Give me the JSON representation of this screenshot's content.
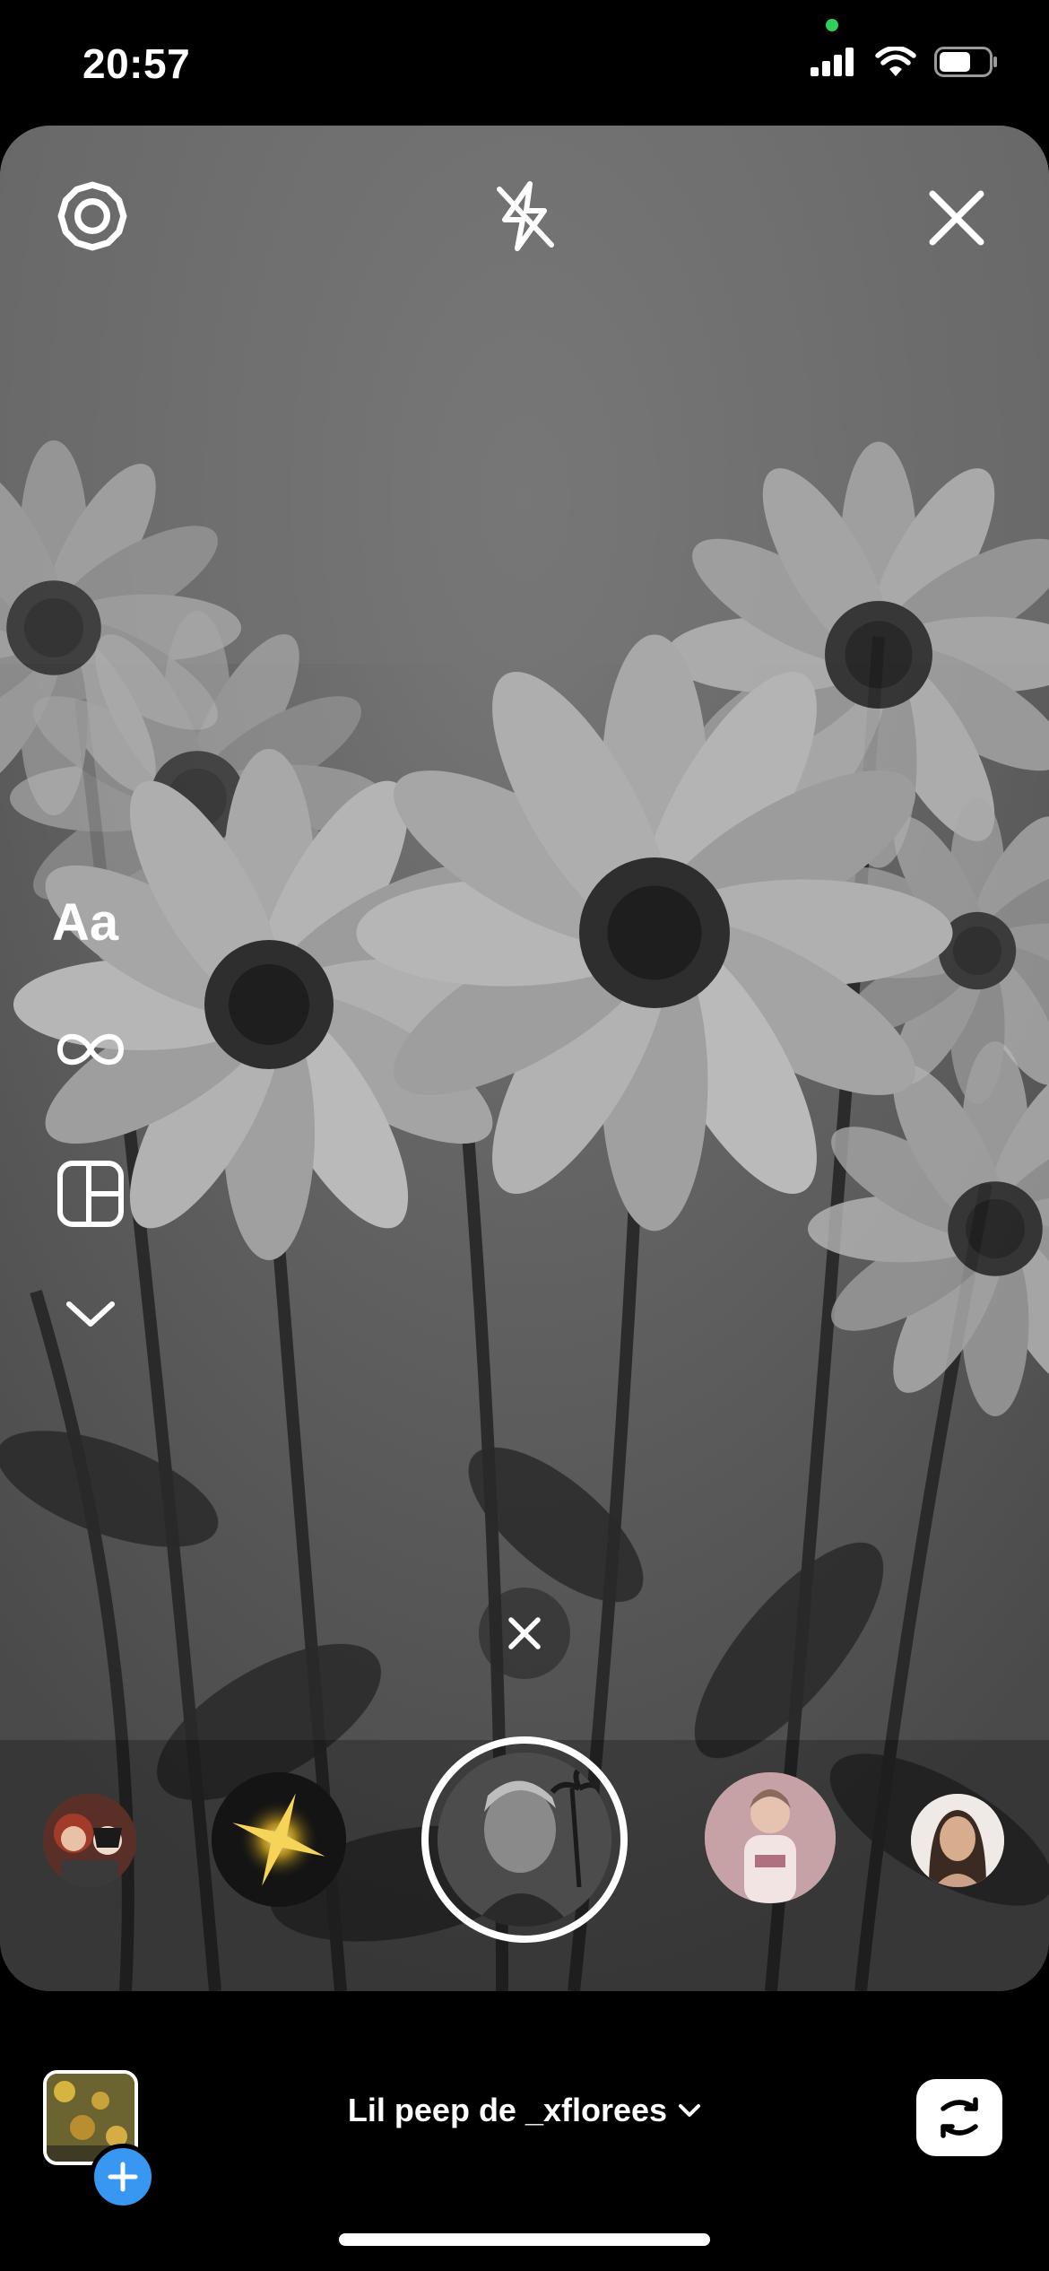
{
  "status_bar": {
    "time": "20:57",
    "icons": [
      "cellular-signal-icon",
      "wifi-icon",
      "battery-icon"
    ],
    "privacy_indicator_color": "#30d158"
  },
  "camera": {
    "top_controls": [
      "settings-gear-icon",
      "flash-off-icon",
      "close-icon"
    ],
    "left_tools": {
      "text_label": "Aa",
      "icons": [
        "boomerang-infinity-icon",
        "layout-grid-icon",
        "chevron-down-icon"
      ]
    },
    "effect_remove_icon": "close-icon",
    "effects_carousel": [
      {
        "name": "effect-1",
        "icon": "avatar-illustration"
      },
      {
        "name": "effect-2",
        "icon": "sparkle-star"
      },
      {
        "name": "lil-peep-effect",
        "icon": "selected-effect",
        "selected": true
      },
      {
        "name": "effect-4",
        "icon": "avatar-pink"
      },
      {
        "name": "effect-5",
        "icon": "avatar-portrait"
      }
    ]
  },
  "bottom_bar": {
    "effect_name": "Lil peep de _xflorees",
    "gallery_icon": "gallery-thumbnail",
    "add_icon": "plus-icon",
    "flip_icon": "camera-flip-icon"
  },
  "colors": {
    "accent_blue": "#3897f0",
    "background": "#000000",
    "foreground": "#ffffff"
  }
}
